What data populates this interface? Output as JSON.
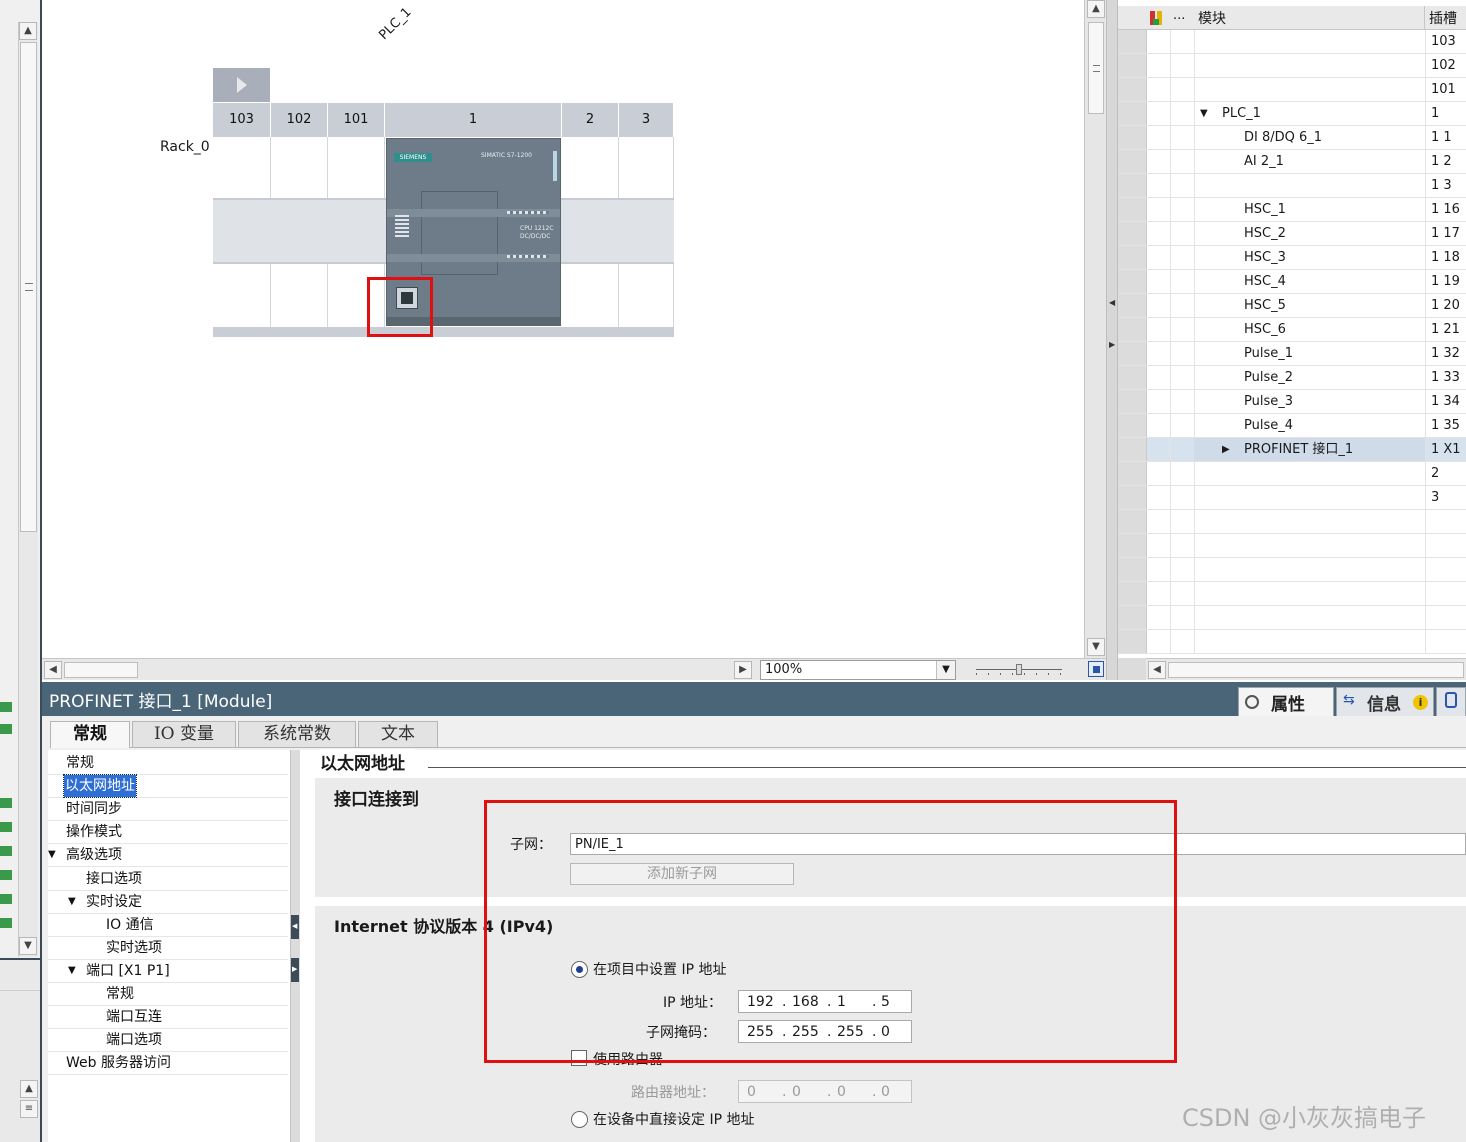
{
  "device_view": {
    "plc_label": "PLC_1",
    "rack_label": "Rack_0",
    "slots": [
      "103",
      "102",
      "101",
      "1",
      "2",
      "3"
    ],
    "cpu_brand": "SIEMENS",
    "cpu_series": "SIMATIC S7-1200",
    "cpu_model_line1": "CPU 1212C",
    "cpu_model_line2": "DC/DC/DC",
    "zoom": "100%"
  },
  "module_table": {
    "header_dots": "...",
    "header_module": "模块",
    "header_slot": "插槽",
    "rows": [
      {
        "name": "",
        "slot": "103",
        "indent": 0,
        "toggle": ""
      },
      {
        "name": "",
        "slot": "102",
        "indent": 0,
        "toggle": ""
      },
      {
        "name": "",
        "slot": "101",
        "indent": 0,
        "toggle": ""
      },
      {
        "name": "PLC_1",
        "slot": "1",
        "indent": 1,
        "toggle": "▼"
      },
      {
        "name": "DI 8/DQ 6_1",
        "slot": "1 1",
        "indent": 2,
        "toggle": ""
      },
      {
        "name": "AI 2_1",
        "slot": "1 2",
        "indent": 2,
        "toggle": ""
      },
      {
        "name": "",
        "slot": "1 3",
        "indent": 2,
        "toggle": ""
      },
      {
        "name": "HSC_1",
        "slot": "1 16",
        "indent": 2,
        "toggle": ""
      },
      {
        "name": "HSC_2",
        "slot": "1 17",
        "indent": 2,
        "toggle": ""
      },
      {
        "name": "HSC_3",
        "slot": "1 18",
        "indent": 2,
        "toggle": ""
      },
      {
        "name": "HSC_4",
        "slot": "1 19",
        "indent": 2,
        "toggle": ""
      },
      {
        "name": "HSC_5",
        "slot": "1 20",
        "indent": 2,
        "toggle": ""
      },
      {
        "name": "HSC_6",
        "slot": "1 21",
        "indent": 2,
        "toggle": ""
      },
      {
        "name": "Pulse_1",
        "slot": "1 32",
        "indent": 2,
        "toggle": ""
      },
      {
        "name": "Pulse_2",
        "slot": "1 33",
        "indent": 2,
        "toggle": ""
      },
      {
        "name": "Pulse_3",
        "slot": "1 34",
        "indent": 2,
        "toggle": ""
      },
      {
        "name": "Pulse_4",
        "slot": "1 35",
        "indent": 2,
        "toggle": ""
      },
      {
        "name": "PROFINET 接口_1",
        "slot": "1 X1",
        "indent": 2,
        "toggle": "▶",
        "selected": true
      },
      {
        "name": "",
        "slot": "2",
        "indent": 0,
        "toggle": ""
      },
      {
        "name": "",
        "slot": "3",
        "indent": 0,
        "toggle": ""
      },
      {
        "name": "",
        "slot": "",
        "indent": 0,
        "toggle": ""
      },
      {
        "name": "",
        "slot": "",
        "indent": 0,
        "toggle": ""
      },
      {
        "name": "",
        "slot": "",
        "indent": 0,
        "toggle": ""
      },
      {
        "name": "",
        "slot": "",
        "indent": 0,
        "toggle": ""
      },
      {
        "name": "",
        "slot": "",
        "indent": 0,
        "toggle": ""
      },
      {
        "name": "",
        "slot": "",
        "indent": 0,
        "toggle": ""
      }
    ]
  },
  "inspector": {
    "title": "PROFINET 接口_1 [Module]",
    "right_tabs": {
      "properties": "属性",
      "info": "信息"
    },
    "tabs": [
      "常规",
      "IO 变量",
      "系统常数",
      "文本"
    ],
    "nav": [
      {
        "label": "常规",
        "indent": 0,
        "toggle": ""
      },
      {
        "label": "以太网地址",
        "indent": 0,
        "toggle": "",
        "selected": true
      },
      {
        "label": "时间同步",
        "indent": 0,
        "toggle": ""
      },
      {
        "label": "操作模式",
        "indent": 0,
        "toggle": ""
      },
      {
        "label": "高级选项",
        "indent": 0,
        "toggle": "▼"
      },
      {
        "label": "接口选项",
        "indent": 1,
        "toggle": ""
      },
      {
        "label": "实时设定",
        "indent": 1,
        "toggle": "▼"
      },
      {
        "label": "IO 通信",
        "indent": 2,
        "toggle": ""
      },
      {
        "label": "实时选项",
        "indent": 2,
        "toggle": ""
      },
      {
        "label": "端口 [X1 P1]",
        "indent": 1,
        "toggle": "▼"
      },
      {
        "label": "常规",
        "indent": 2,
        "toggle": ""
      },
      {
        "label": "端口互连",
        "indent": 2,
        "toggle": ""
      },
      {
        "label": "端口选项",
        "indent": 2,
        "toggle": ""
      },
      {
        "label": "Web 服务器访问",
        "indent": 0,
        "toggle": ""
      }
    ],
    "section_title": "以太网地址",
    "interface": {
      "heading": "接口连接到",
      "subnet_label": "子网：",
      "subnet_value": "PN/IE_1",
      "add_subnet_button": "添加新子网"
    },
    "ipv4": {
      "heading": "Internet 协议版本 4 (IPv4)",
      "set_in_project": "在项目中设置 IP 地址",
      "ip_label": "IP 地址：",
      "ip_octets": [
        "192",
        "168",
        "1",
        "5"
      ],
      "mask_label": "子网掩码：",
      "mask_octets": [
        "255",
        "255",
        "255",
        "0"
      ],
      "use_router": "使用路由器",
      "router_label": "路由器地址：",
      "router_octets": [
        "0",
        "0",
        "0",
        "0"
      ],
      "set_on_device": "在设备中直接设定 IP 地址"
    },
    "watermark": "CSDN @小灰灰搞电子"
  },
  "colors": {
    "highlight_red": "#e01010",
    "selection_blue": "#2f6fd3",
    "cpu_body": "#6b7a86",
    "header_bar": "#4a6478"
  }
}
